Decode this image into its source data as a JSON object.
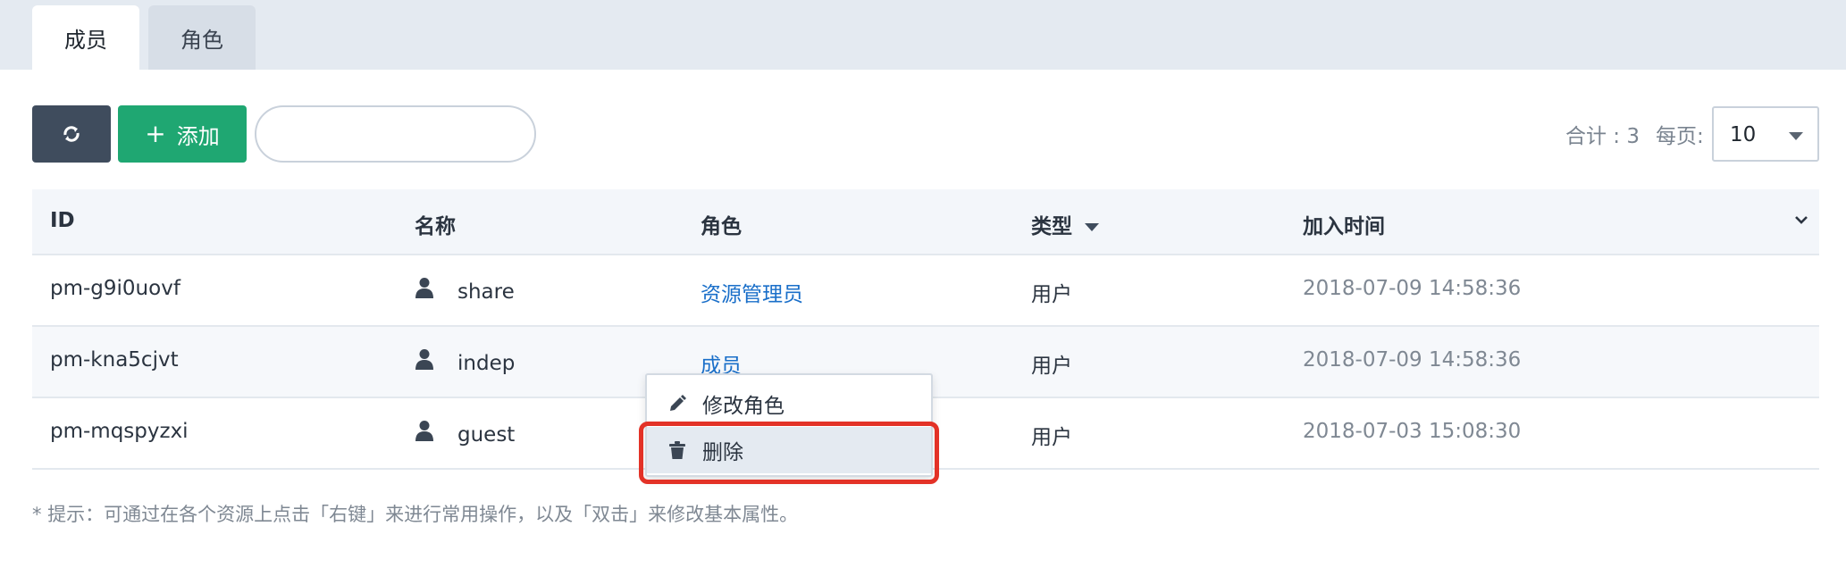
{
  "tabs": [
    {
      "label": "成员",
      "active": true
    },
    {
      "label": "角色",
      "active": false
    }
  ],
  "toolbar": {
    "add_label": "添加",
    "add_plus": "+",
    "search_value": "",
    "total_text": "合计 : 3",
    "perpage_label": "每页:",
    "perpage_value": "10"
  },
  "table": {
    "headers": [
      "ID",
      "名称",
      "角色",
      "类型",
      "加入时间"
    ],
    "rows": [
      {
        "id": "pm-g9i0uovf",
        "name": "share",
        "role": "资源管理员",
        "type": "用户",
        "joined": "2018-07-09 14:58:36"
      },
      {
        "id": "pm-kna5cjvt",
        "name": "indep",
        "role": "成员",
        "type": "用户",
        "joined": "2018-07-09 14:58:36"
      },
      {
        "id": "pm-mqspyzxi",
        "name": "guest",
        "role": "",
        "type": "用户",
        "joined": "2018-07-03 15:08:30"
      }
    ]
  },
  "context_menu": {
    "items": [
      {
        "label": "修改角色",
        "icon": "pencil-icon"
      },
      {
        "label": "删除",
        "icon": "trash-icon"
      }
    ]
  },
  "hint": "* 提示：可通过在各个资源上点击「右键」来进行常用操作，以及「双击」来修改基本属性。",
  "colors": {
    "tabbar_bg": "#e4eaf1",
    "refresh_btn": "#3f4c5d",
    "add_btn": "#1fa772",
    "link": "#1a6fc9",
    "highlight": "#e33227"
  }
}
